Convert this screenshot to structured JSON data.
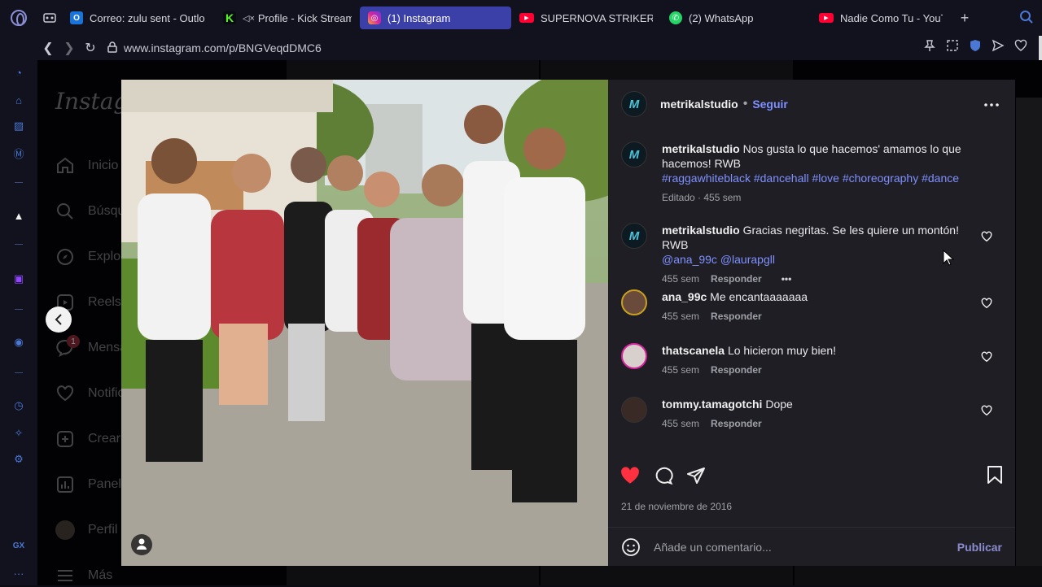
{
  "tabs": [
    {
      "label": "Correo: zulu sent - Outlo",
      "icon": "outlook-icon",
      "color": "#1a73d8"
    },
    {
      "label": "Profile - Kick Stream",
      "icon": "kick-icon",
      "color": "#53fc18"
    },
    {
      "label": "(1) Instagram",
      "icon": "instagram-icon",
      "color": "#d6249f",
      "active": true
    },
    {
      "label": "SUPERNOVA STRIKERS",
      "icon": "youtube-icon",
      "color": "#ff0033"
    },
    {
      "label": "(2) WhatsApp",
      "icon": "whatsapp-icon",
      "color": "#25d366"
    },
    {
      "label": "Nadie Como Tu - YouTub",
      "icon": "youtube-icon",
      "color": "#ff0033"
    }
  ],
  "address": {
    "url": "www.instagram.com/p/BNGVeqdDMC6"
  },
  "browser_sidebar": {
    "gx_label": "GX",
    "more": "···"
  },
  "ig_nav": {
    "logo": "Instagram",
    "items": [
      {
        "label": "Inicio",
        "icon": "home-icon"
      },
      {
        "label": "Búsqueda",
        "icon": "search-icon"
      },
      {
        "label": "Explorar",
        "icon": "explore-icon"
      },
      {
        "label": "Reels",
        "icon": "reels-icon"
      },
      {
        "label": "Mensajes",
        "icon": "messenger-icon",
        "badge": "1"
      },
      {
        "label": "Notificaciones",
        "icon": "heart-icon"
      },
      {
        "label": "Crear",
        "icon": "create-icon"
      },
      {
        "label": "Panel",
        "icon": "dashboard-icon"
      },
      {
        "label": "Perfil",
        "icon": "profile-icon"
      },
      {
        "label": "Más",
        "icon": "menu-icon"
      }
    ]
  },
  "post": {
    "author": "metrikalstudio",
    "follow": "Seguir",
    "avatar_letter": "M",
    "caption": {
      "text": "Nos gusta lo que hacemos' amamos lo que hacemos! RWB",
      "hashtags": "#raggawhiteblack #dancehall #love #choreography #dance",
      "meta": "Editado · 455 sem"
    },
    "comments": [
      {
        "user": "metrikalstudio",
        "text": "Gracias negritas. Se les quiere un montón! RWB",
        "mentions": "@ana_99c @laurapgll",
        "time": "455 sem",
        "reply": "Responder",
        "more": "•••"
      },
      {
        "user": "ana_99c",
        "text": "Me encantaaaaaaa",
        "time": "455 sem",
        "reply": "Responder"
      },
      {
        "user": "thatscanela",
        "text": "Lo hicieron muy bien!",
        "time": "455 sem",
        "reply": "Responder"
      },
      {
        "user": "tommy.tamagotchi",
        "text": "Dope",
        "time": "455 sem",
        "reply": "Responder"
      }
    ],
    "date": "21 de noviembre de 2016",
    "add_comment_placeholder": "Añade un comentario...",
    "publish": "Publicar",
    "liked": true
  },
  "colors": {
    "accent": "#3b3fa8",
    "like": "#ff3040",
    "link": "#7f90ff"
  }
}
